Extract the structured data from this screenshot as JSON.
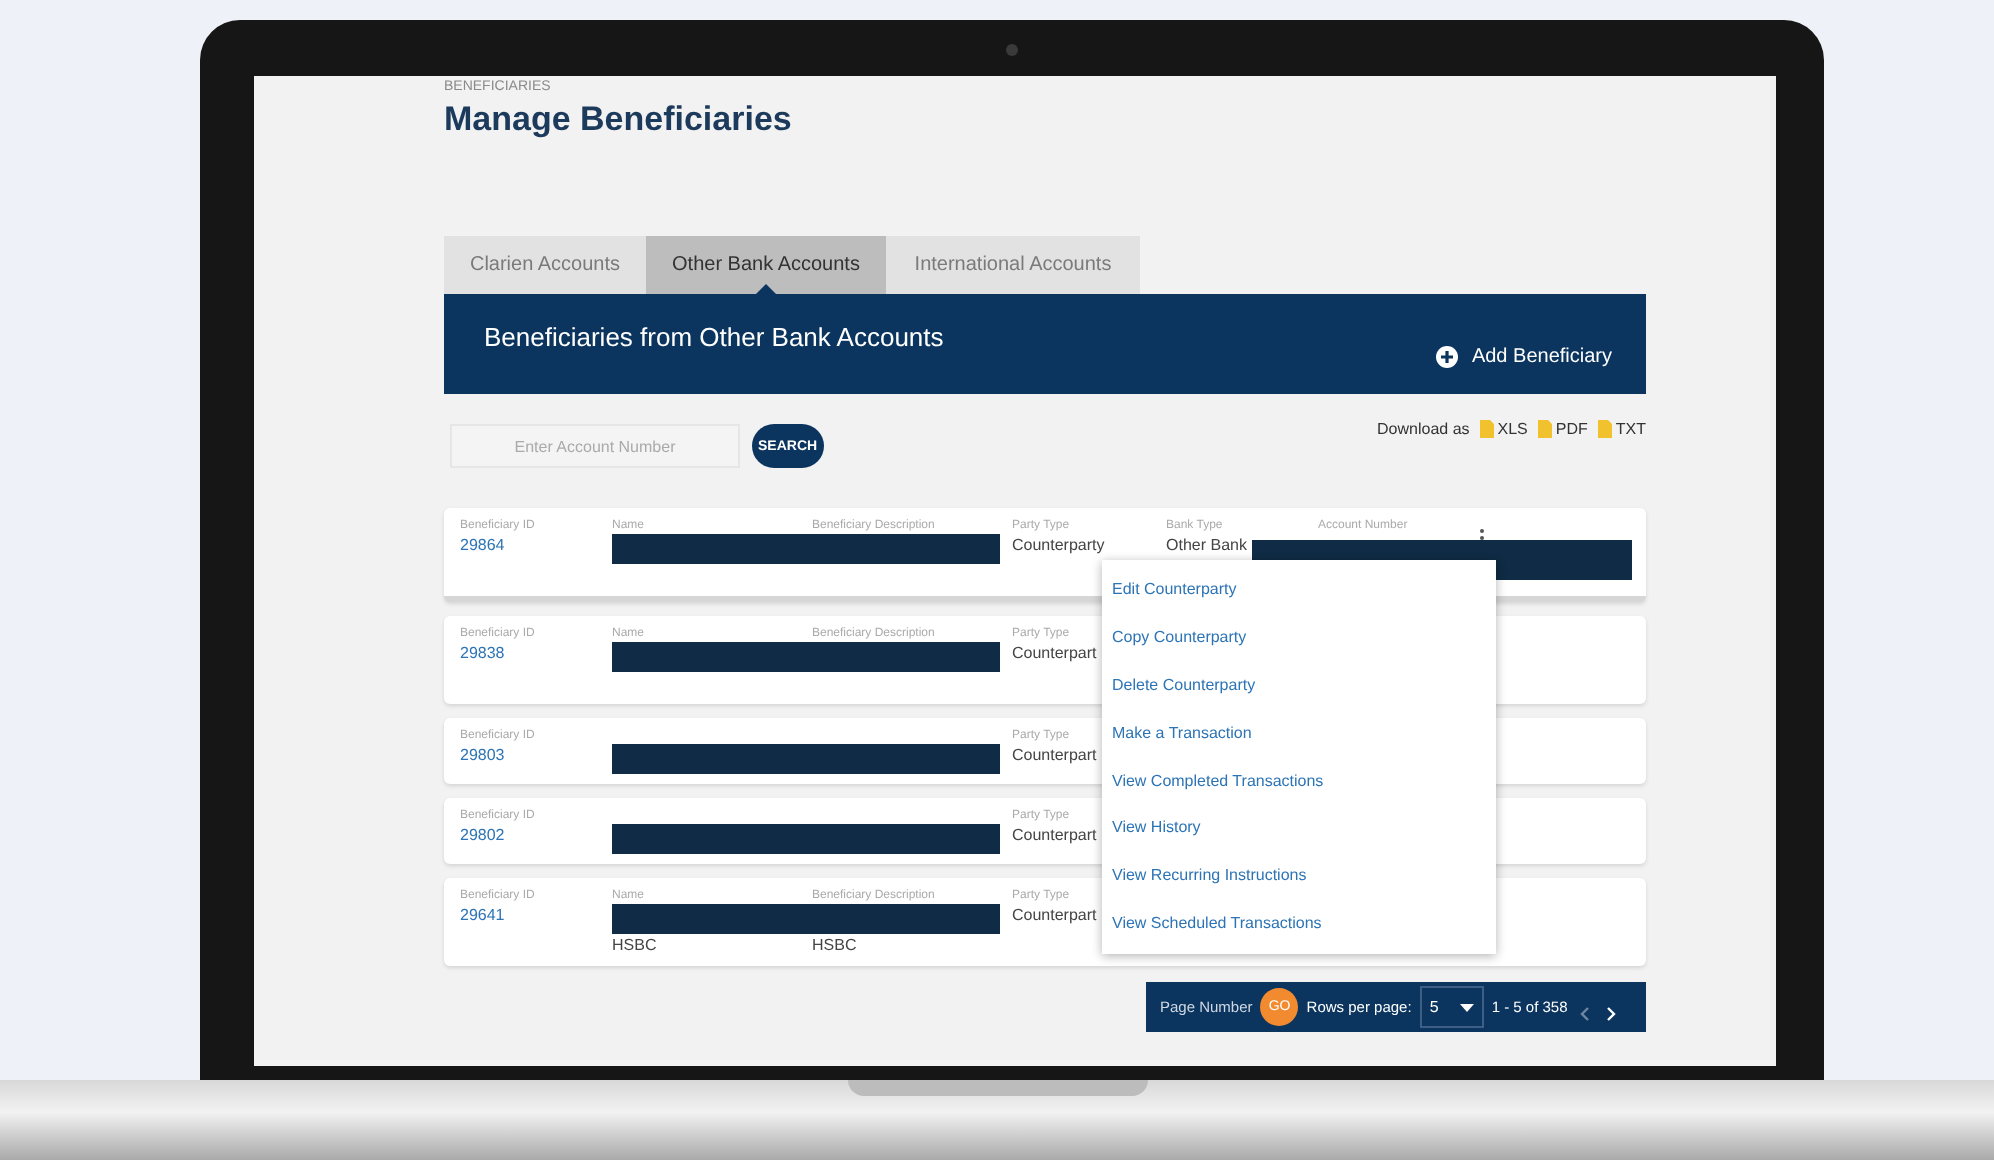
{
  "breadcrumb": "BENEFICIARIES",
  "title": "Manage Beneficiaries",
  "tabs": [
    {
      "label": "Clarien Accounts",
      "selected": false
    },
    {
      "label": "Other Bank Accounts",
      "selected": true
    },
    {
      "label": "International Accounts",
      "selected": false
    }
  ],
  "header": {
    "title": "Beneficiaries from Other Bank Accounts",
    "add_button": "Add Beneficiary"
  },
  "search": {
    "placeholder": "Enter Account Number",
    "button": "SEARCH"
  },
  "download": {
    "label": "Download as",
    "formats": [
      "XLS",
      "PDF",
      "TXT"
    ]
  },
  "rows": [
    {
      "beneficiary_id": {
        "label": "Beneficiary ID",
        "value": "29864"
      },
      "name": {
        "label": "Name"
      },
      "description": {
        "label": "Beneficiary Description"
      },
      "party_type": {
        "label": "Party Type",
        "value": "Counterparty"
      },
      "bank_type": {
        "label": "Bank Type",
        "value": "Other Bank"
      },
      "account_number": {
        "label": "Account Number"
      },
      "names_redacted": true,
      "account_redacted": true
    },
    {
      "beneficiary_id": {
        "label": "Beneficiary ID",
        "value": "29838"
      },
      "name": {
        "label": "Name"
      },
      "description": {
        "label": "Beneficiary Description"
      },
      "party_type": {
        "label": "Party Type",
        "value": "Counterpart"
      },
      "names_redacted": true,
      "account_redacted": false
    },
    {
      "beneficiary_id": {
        "label": "Beneficiary ID",
        "value": "29803"
      },
      "party_type": {
        "label": "Party Type",
        "value": "Counterpart"
      },
      "names_redacted": true,
      "account_redacted": false
    },
    {
      "beneficiary_id": {
        "label": "Beneficiary ID",
        "value": "29802"
      },
      "party_type": {
        "label": "Party Type",
        "value": "Counterpart"
      },
      "names_redacted": true,
      "account_redacted": false
    },
    {
      "beneficiary_id": {
        "label": "Beneficiary ID",
        "value": "29641"
      },
      "name": {
        "label": "Name",
        "value": "HSBC"
      },
      "description": {
        "label": "Beneficiary Description",
        "value": "HSBC"
      },
      "party_type": {
        "label": "Party Type",
        "value": "Counterpart"
      },
      "names_redacted": true,
      "account_redacted": false
    }
  ],
  "menu": [
    "Edit Counterparty",
    "Copy Counterparty",
    "Delete Counterparty",
    "Make a Transaction",
    "View Completed Transactions",
    "View History",
    "View Recurring Instructions",
    "View Scheduled Transactions"
  ],
  "pagination": {
    "page_number_label": "Page Number",
    "go": "GO",
    "rows_label": "Rows per page:",
    "rows_value": "5",
    "range": "1 - 5 of 358"
  }
}
